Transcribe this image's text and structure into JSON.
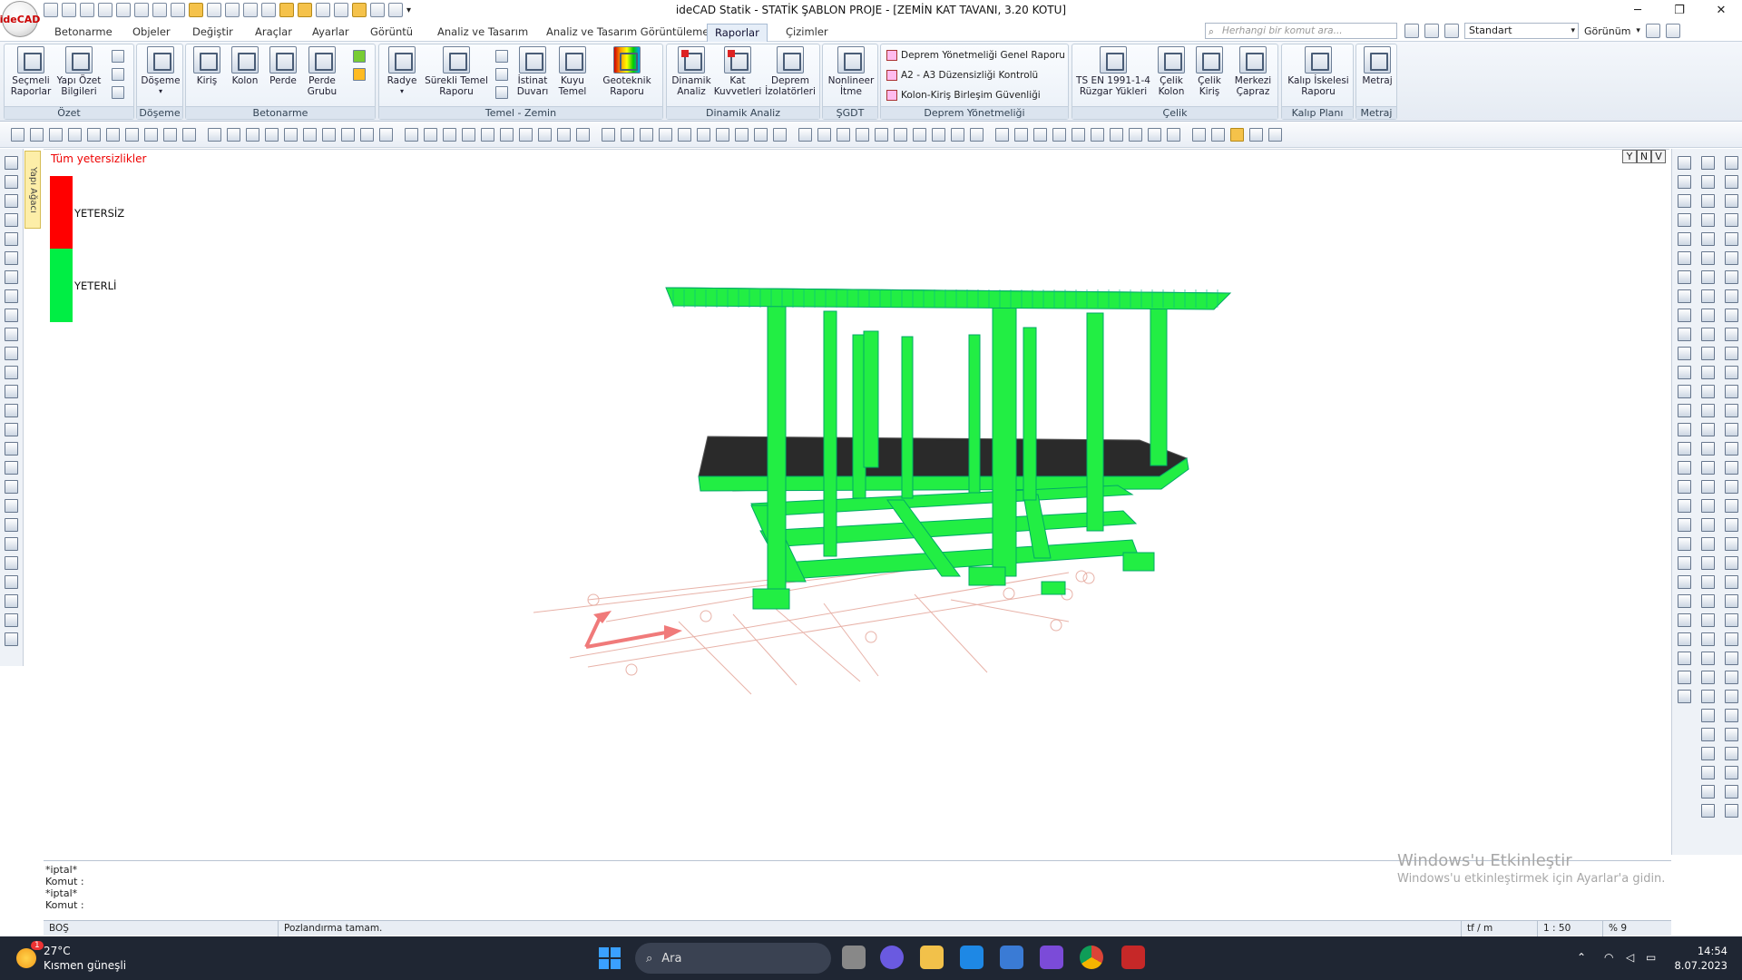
{
  "app": {
    "logo": "ideCAD",
    "title": "ideCAD Statik - STATİK ŞABLON PROJE - [ZEMİN KAT TAVANI,  3.20 KOTU]"
  },
  "tabs": [
    "Betonarme",
    "Objeler",
    "Değiştir",
    "Araçlar",
    "Ayarlar",
    "Görüntü",
    "Analiz ve Tasarım",
    "Analiz ve Tasarım Görüntüleme",
    "Raporlar",
    "Çizimler"
  ],
  "active_tab": "Raporlar",
  "search": {
    "placeholder": "Herhangi bir komut ara..."
  },
  "right_toolbar": {
    "style_value": "Standart",
    "view_label": "Görünüm"
  },
  "ribbon": {
    "groups": [
      "Özet",
      "Döşeme",
      "Betonarme",
      "Temel - Zemin",
      "Dinamik Analiz",
      "ŞGDT",
      "Deprem Yönetmeliği",
      "Çelik",
      "Kalıp Planı",
      "Metraj"
    ],
    "buttons": {
      "secmeli": "Seçmeli Raporlar",
      "yapi_ozet": "Yapı Özet Bilgileri",
      "doseme": "Döşeme",
      "kiris": "Kiriş",
      "kolon": "Kolon",
      "perde": "Perde",
      "perde_grubu": "Perde Grubu",
      "radye": "Radye",
      "surekli_temel": "Sürekli Temel Raporu",
      "istinat": "İstinat Duvarı",
      "kuyu": "Kuyu Temel",
      "geoteknik": "Geoteknik Raporu",
      "dinamik": "Dinamik Analiz",
      "kat_kuv": "Kat Kuvvetleri",
      "deprem_izo": "Deprem İzolatörleri",
      "nonlineer": "Nonlineer İtme",
      "ts_en": "TS EN 1991-1-4 Rüzgar Yükleri",
      "celik_kolon": "Çelik Kolon",
      "celik_kiris": "Çelik Kiriş",
      "merkezi": "Merkezi Çapraz",
      "kalip": "Kalıp İskelesi Raporu",
      "metraj": "Metraj"
    },
    "deprem_list": [
      "Deprem Yönetmeliği Genel Raporu",
      "A2 - A3 Düzensizliği Kontrolü",
      "Kolon-Kiriş Birleşim Güvenliği"
    ]
  },
  "yapi_agaci": "Yapı Ağacı",
  "legend": {
    "title": "Tüm yetersizlikler",
    "items": [
      {
        "label": "YETERSİZ",
        "color": "#ff0000"
      },
      {
        "label": "YETERLİ",
        "color": "#00ee44"
      }
    ]
  },
  "view_buttons": [
    "Y",
    "N",
    "V"
  ],
  "model": {
    "member_color": "#22ee44",
    "slab_color": "#2a2a2a",
    "axis_color": "#e8b2a8",
    "ucs_color": "#f07a7a"
  },
  "command_lines": [
    "*iptal*",
    "Komut :",
    "*iptal*",
    "Komut :"
  ],
  "status": {
    "left": "BOŞ",
    "message": "Pozlandırma tamam.",
    "units": "tf / m",
    "scale": "1 : 50",
    "zoom": "% 9"
  },
  "watermark": {
    "line1": "Windows'u Etkinleştir",
    "line2": "Windows'u etkinleştirmek için Ayarlar'a gidin."
  },
  "taskbar": {
    "temp": "27°C",
    "weather": "Kısmen güneşli",
    "badge": "1",
    "search": "Ara",
    "time": "14:54",
    "date": "8.07.2023"
  }
}
